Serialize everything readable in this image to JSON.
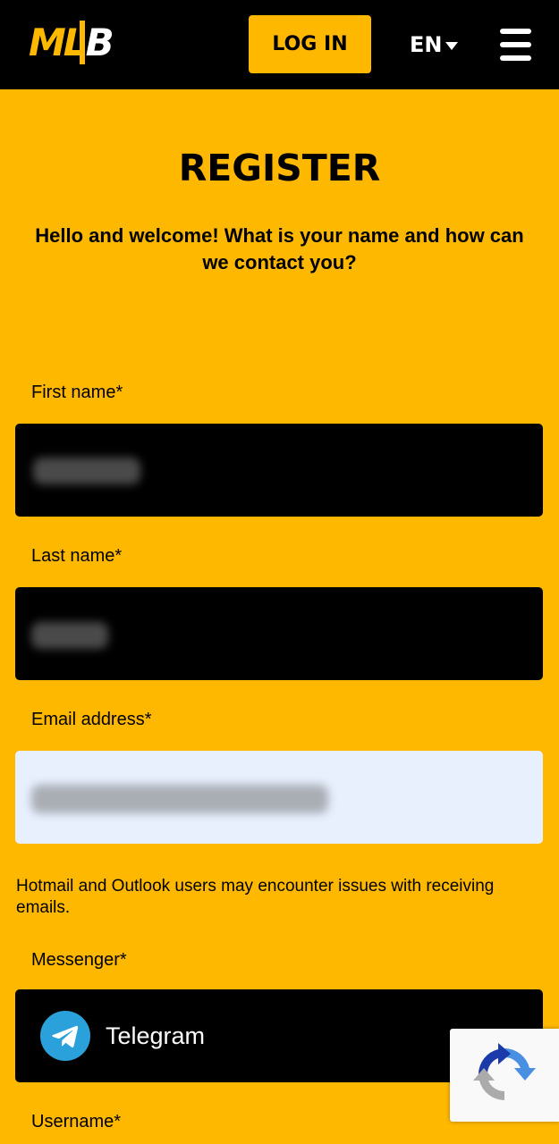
{
  "header": {
    "logo_text_a": "ML",
    "logo_text_b": "B",
    "login_label": "LOG IN",
    "language": "EN"
  },
  "page": {
    "title": "REGISTER",
    "subtitle": "Hello and welcome! What is your name and how can we contact you?"
  },
  "form": {
    "first_name_label": "First name*",
    "last_name_label": "Last name*",
    "email_label": "Email address*",
    "email_hint": "Hotmail and Outlook users may encounter issues with receiving emails.",
    "messenger_label": "Messenger*",
    "messenger_value": "Telegram",
    "username_label": "Username*"
  },
  "colors": {
    "brand_yellow": "#FFB800",
    "header_black": "#000000",
    "autofill_blue": "#E8F0FE",
    "telegram_blue": "#2AA1DA"
  },
  "icons": {
    "menu": "hamburger-icon",
    "language_caret": "caret-down-icon",
    "messenger": "telegram-icon",
    "captcha": "recaptcha-icon"
  }
}
